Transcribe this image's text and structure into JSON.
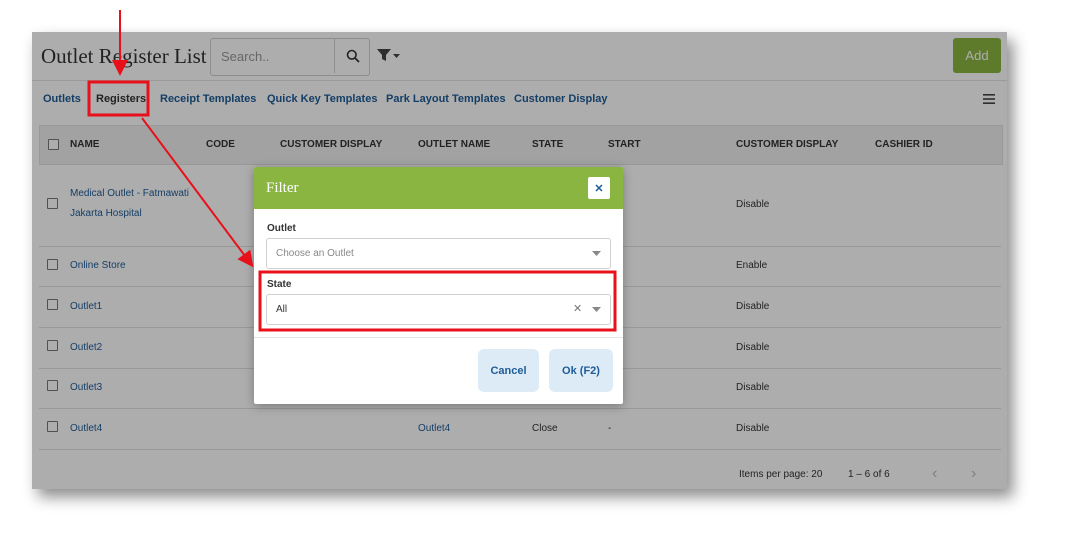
{
  "header": {
    "title": "Outlet Register List",
    "search_placeholder": "Search..",
    "search_icon": "search-icon",
    "filter_icon": "filter-icon",
    "add_label": "Add"
  },
  "tabs": [
    {
      "label": "Outlets"
    },
    {
      "label": "Registers",
      "active": true
    },
    {
      "label": "Receipt Templates"
    },
    {
      "label": "Quick Key Templates"
    },
    {
      "label": "Park Layout Templates"
    },
    {
      "label": "Customer Display"
    }
  ],
  "menu_icon": "hamburger-menu-icon",
  "table": {
    "columns": [
      "NAME",
      "CODE",
      "CUSTOMER DISPLAY",
      "OUTLET NAME",
      "STATE",
      "START",
      "CUSTOMER DISPLAY",
      "CASHIER ID"
    ],
    "rows": [
      {
        "name_line1": "Medical Outlet - Fatmawati",
        "name_line2": "Jakarta Hospital",
        "outlet": "",
        "state": "",
        "start": "",
        "display": "Disable"
      },
      {
        "name": "Online Store",
        "outlet": "",
        "state": "",
        "start": "",
        "display": "Enable"
      },
      {
        "name": "Outlet1",
        "outlet": "",
        "state": "",
        "start": "",
        "display": "Disable"
      },
      {
        "name": "Outlet2",
        "outlet": "",
        "state": "",
        "start": "",
        "display": "Disable"
      },
      {
        "name": "Outlet3",
        "outlet": "",
        "state": "",
        "start": "",
        "display": "Disable"
      },
      {
        "name": "Outlet4",
        "outlet": "Outlet4",
        "state": "Close",
        "start": "-",
        "display": "Disable"
      }
    ]
  },
  "pagination": {
    "items_per_page": "Items per page: 20",
    "range": "1 – 6 of 6",
    "prev": "‹",
    "next": "›"
  },
  "modal": {
    "title": "Filter",
    "close": "✕",
    "outlet_label": "Outlet",
    "outlet_placeholder": "Choose an Outlet",
    "state_label": "State",
    "state_value": "All",
    "clear": "✕",
    "cancel_label": "Cancel",
    "ok_label": "Ok (F2)"
  },
  "colors": {
    "accent_green": "#8ab540",
    "link_blue": "#1f5c97",
    "annotation_red": "#e8101a",
    "button_light_blue": "#ddebf7"
  }
}
